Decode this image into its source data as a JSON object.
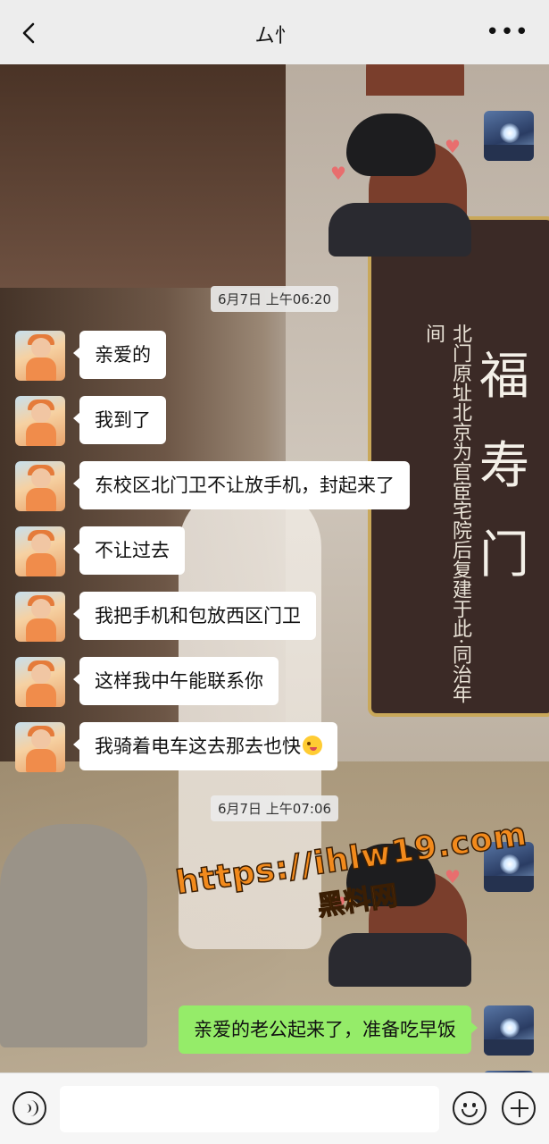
{
  "header": {
    "title": "ム忄",
    "back_icon": "chevron-left-icon",
    "more_icon": "more-dots-icon",
    "more_label": "•••"
  },
  "background": {
    "sign_big": "福寿门",
    "sign_small": "北门原址北京为官宦宅院后复建于此·同治年间"
  },
  "messages": [
    {
      "type": "sticker",
      "side": "right"
    },
    {
      "type": "timestamp",
      "text": "6月7日 上午06:20"
    },
    {
      "type": "text",
      "side": "left",
      "text": "亲爱的"
    },
    {
      "type": "text",
      "side": "left",
      "text": "我到了"
    },
    {
      "type": "text",
      "side": "left",
      "text": "东校区北门卫不让放手机，封起来了"
    },
    {
      "type": "text",
      "side": "left",
      "text": "不让过去"
    },
    {
      "type": "text",
      "side": "left",
      "text": "我把手机和包放西区门卫"
    },
    {
      "type": "text",
      "side": "left",
      "text": "这样我中午能联系你"
    },
    {
      "type": "text",
      "side": "left",
      "text": "我骑着电车这去那去也快",
      "emoji": "winking-face-tongue"
    },
    {
      "type": "timestamp",
      "text": "6月7日 上午07:06"
    },
    {
      "type": "sticker",
      "side": "right"
    },
    {
      "type": "text",
      "side": "right",
      "text": "亲爱的老公起来了，准备吃早饭"
    }
  ],
  "watermark": {
    "url": "https://ihlw19.com",
    "name": "黑料网"
  },
  "input_bar": {
    "voice_icon": "voice-icon",
    "input_value": "",
    "emoji_icon": "smiley-icon",
    "plus_icon": "plus-icon"
  },
  "colors": {
    "self_bubble": "#95ec69",
    "other_bubble": "#ffffff",
    "header_bg": "#ededed"
  }
}
